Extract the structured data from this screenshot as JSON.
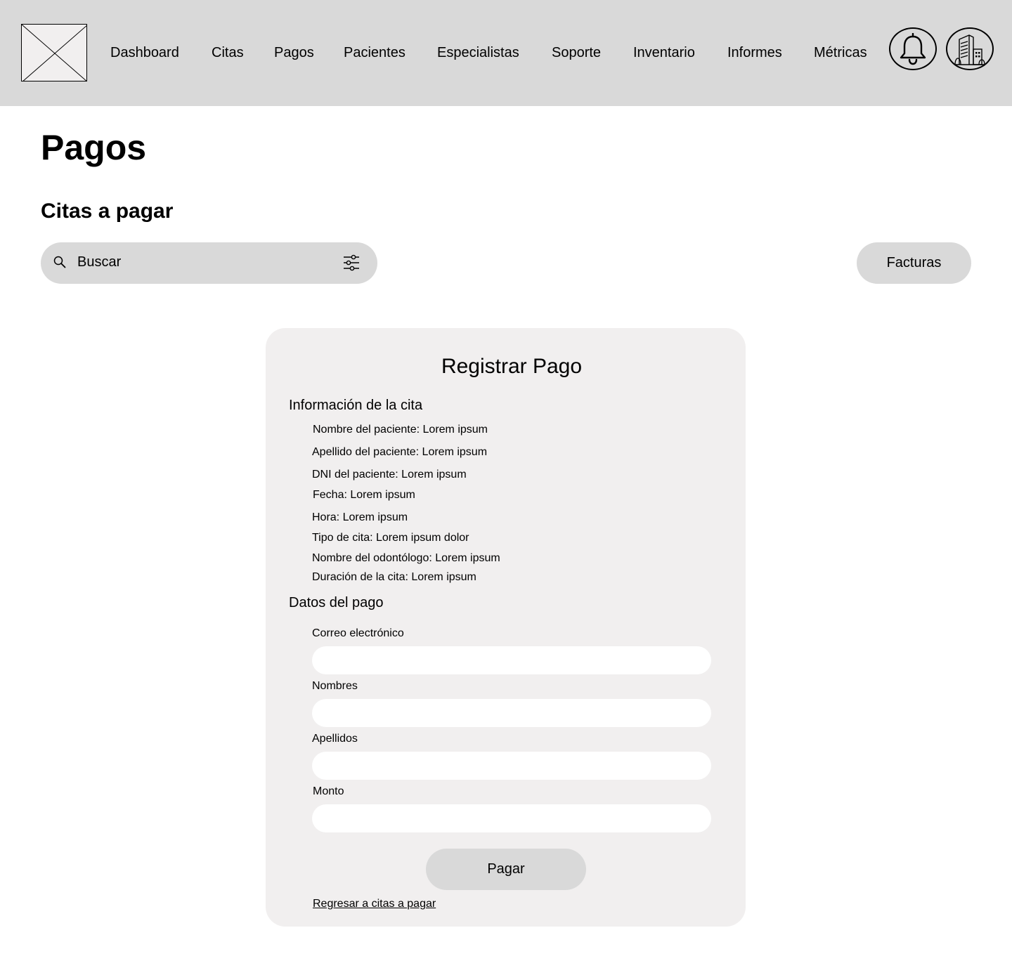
{
  "header": {
    "nav": [
      "Dashboard",
      "Citas",
      "Pagos",
      "Pacientes",
      "Especialistas",
      "Soporte",
      "Inventario",
      "Informes",
      "Métricas"
    ],
    "icons": [
      "bell-icon",
      "building-icon"
    ]
  },
  "page": {
    "title": "Pagos",
    "section_title": "Citas a pagar"
  },
  "search": {
    "placeholder": "Buscar"
  },
  "toolbar": {
    "facturas_label": "Facturas"
  },
  "card": {
    "title": "Registrar Pago",
    "info_heading": "Información de la cita",
    "info_lines": [
      "Nombre del paciente: Lorem ipsum",
      "Apellido del paciente: Lorem ipsum",
      "DNI del paciente: Lorem ipsum",
      "Fecha: Lorem ipsum",
      "Hora: Lorem ipsum",
      "Tipo de cita: Lorem ipsum dolor",
      "Nombre del odontólogo: Lorem ipsum",
      "Duración de la cita: Lorem ipsum"
    ],
    "payment_heading": "Datos del pago",
    "fields": [
      {
        "label": "Correo electrónico",
        "value": ""
      },
      {
        "label": "Nombres",
        "value": ""
      },
      {
        "label": "Apellidos",
        "value": ""
      },
      {
        "label": "Monto",
        "value": ""
      }
    ],
    "submit_label": "Pagar",
    "back_link": "Regresar a citas a pagar"
  }
}
